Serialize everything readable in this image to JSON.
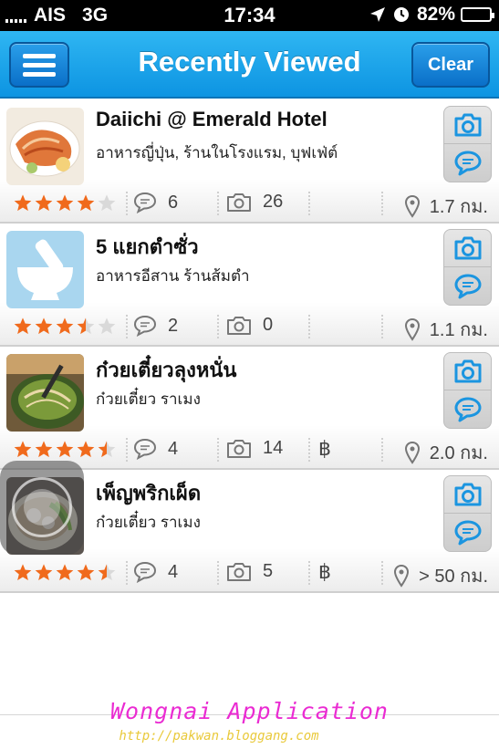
{
  "status_bar": {
    "carrier": "AIS",
    "network": "3G",
    "time": "17:34",
    "battery": "82%",
    "battery_level": 0.82
  },
  "nav": {
    "title": "Recently Viewed",
    "clear_label": "Clear"
  },
  "colors": {
    "nav_blue": "#1aa5ec",
    "star_orange": "#f06a1c",
    "icon_blue": "#1b95e0",
    "watermark_pink": "#ea2bd2",
    "watermark_yellow": "#e9c93a"
  },
  "items": [
    {
      "name": "Daiichi @ Emerald Hotel",
      "category": "อาหารญี่ปุ่น, ร้านในโรงแรม, บุฟเฟ่ต์",
      "rating": 4,
      "reviews": "6",
      "photos": "26",
      "price": "",
      "distance": "1.7 กม.",
      "thumb_icon": "food-photo-icon"
    },
    {
      "name": "5 แยกตำซั่ว",
      "category": "อาหารอีสาน ร้านส้มตำ",
      "rating": 3.5,
      "reviews": "2",
      "photos": "0",
      "price": "",
      "distance": "1.1 กม.",
      "thumb_icon": "mortar-pestle-icon"
    },
    {
      "name": "ก๋วยเตี๋ยวลุงหนั่น",
      "category": "ก๋วยเตี๋ยว ราเมง",
      "rating": 4.5,
      "reviews": "4",
      "photos": "14",
      "price": "฿",
      "distance": "2.0 กม.",
      "thumb_icon": "noodle-photo-icon"
    },
    {
      "name": "เพ็ญพริกเผ็ด",
      "category": "ก๋วยเตี๋ยว ราเมง",
      "rating": 4.5,
      "reviews": "4",
      "photos": "5",
      "price": "฿",
      "distance": "> 50 กม.",
      "thumb_icon": "noodle-bowl-photo-icon"
    }
  ],
  "watermark": {
    "title": "Wongnai Application",
    "url": "http://pakwan.bloggang.com"
  }
}
